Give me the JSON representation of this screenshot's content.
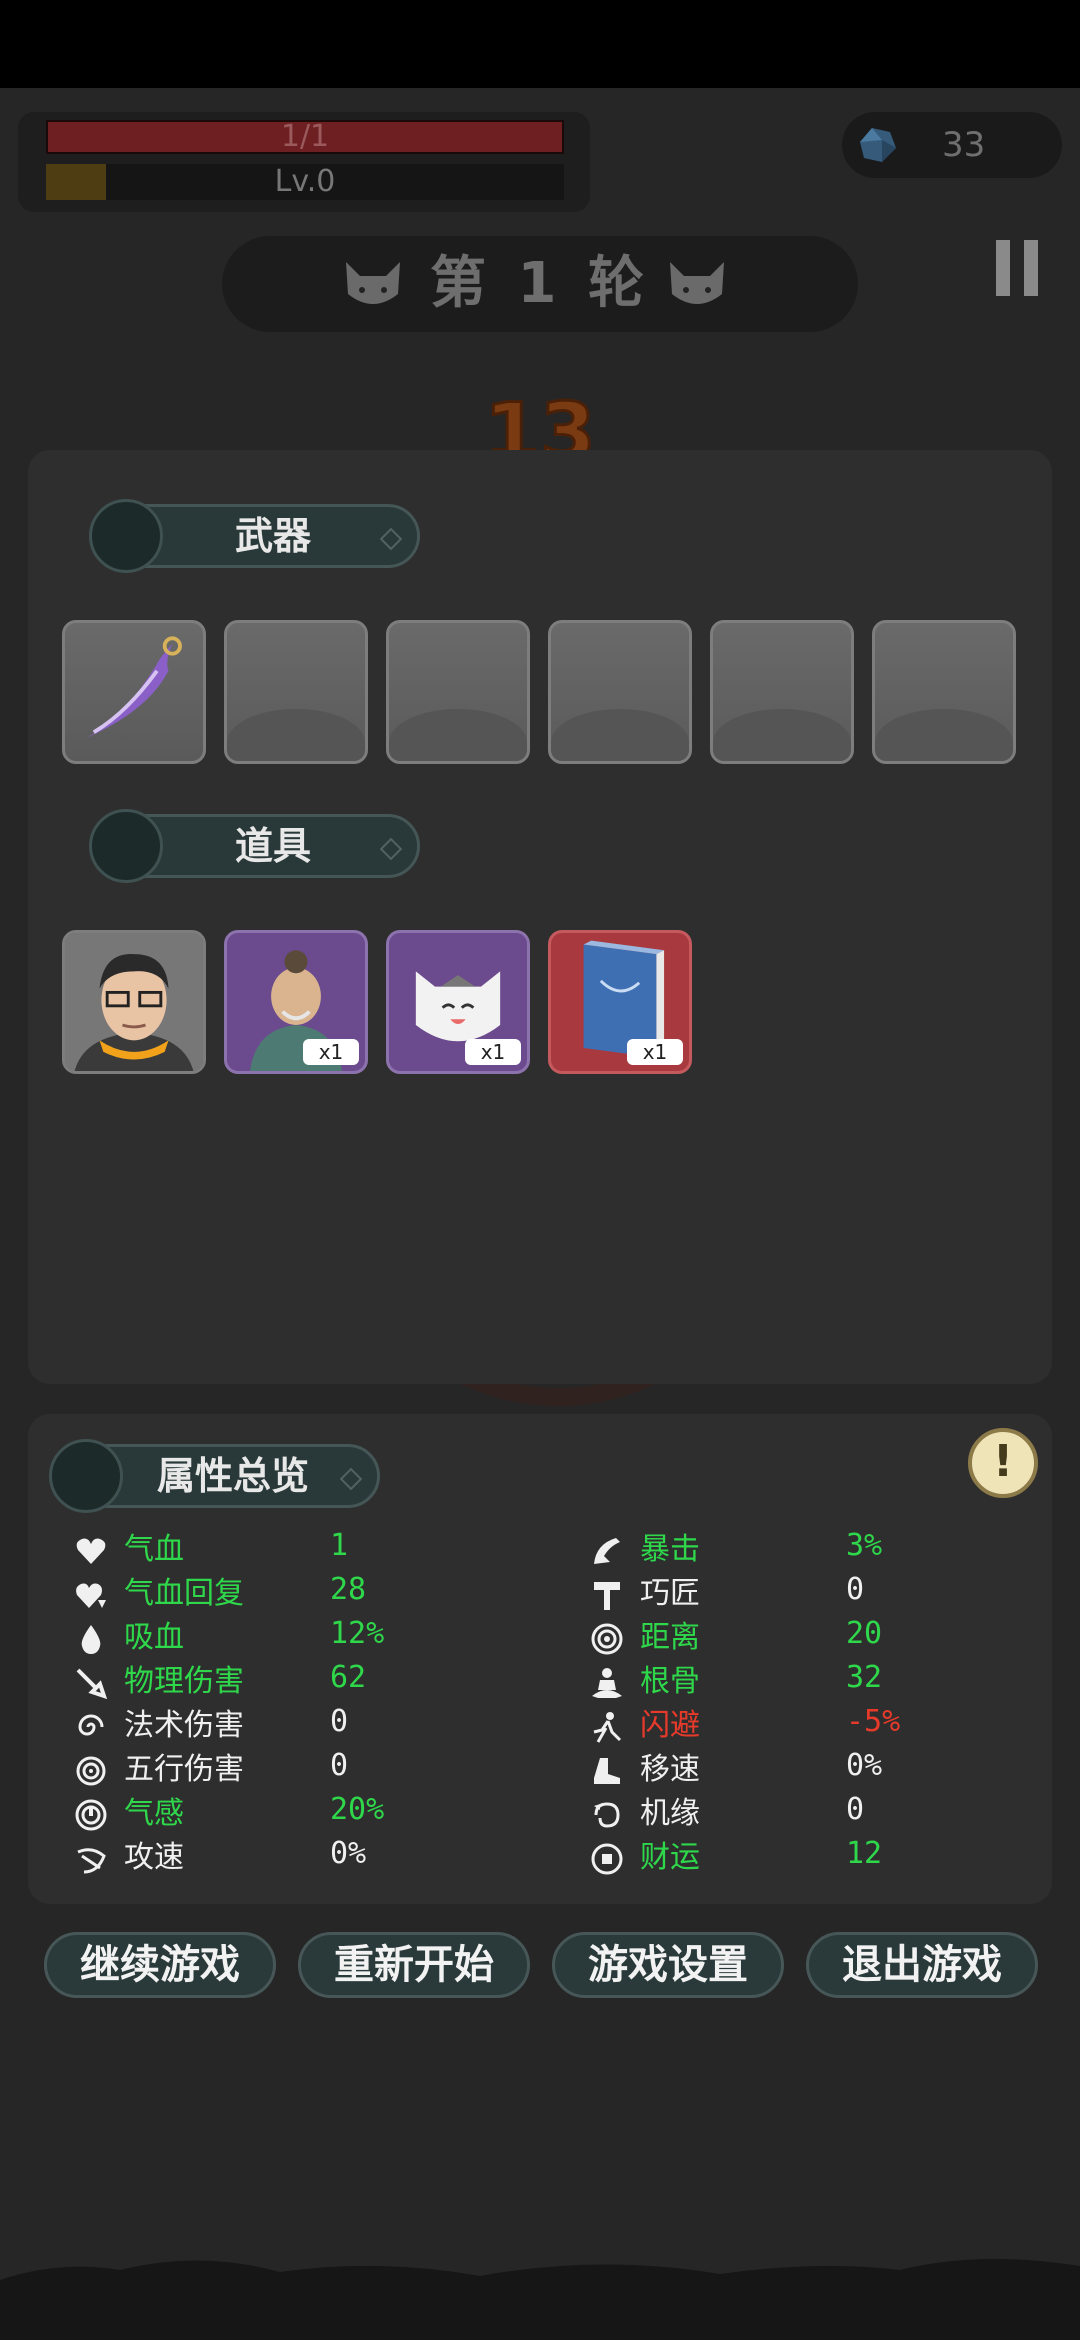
{
  "hud": {
    "hp_text": "1/1",
    "hp_fraction": 1.0,
    "level_text": "Lv.0",
    "gem_count": "33"
  },
  "round": {
    "title": "第 1 轮"
  },
  "timer": "13",
  "weapons": {
    "label": "武器",
    "slots": [
      "purple-scythe-blade",
      "",
      "",
      "",
      "",
      ""
    ]
  },
  "items": {
    "label": "道具",
    "slots": [
      {
        "icon": "glasses-man-portrait",
        "qty": ""
      },
      {
        "icon": "elder-sage-portrait",
        "qty": "x1"
      },
      {
        "icon": "white-cat-portrait",
        "qty": "x1"
      },
      {
        "icon": "blue-book-icon",
        "qty": "x1"
      }
    ]
  },
  "stats": {
    "label": "属性总览",
    "left": [
      {
        "name": "气血",
        "value": "1",
        "icon": "heart-icon",
        "color": "green"
      },
      {
        "name": "气血回复",
        "value": "28",
        "icon": "heart-regen-icon",
        "color": "green"
      },
      {
        "name": "吸血",
        "value": "12%",
        "icon": "blood-drop-icon",
        "color": "green"
      },
      {
        "name": "物理伤害",
        "value": "62",
        "icon": "sword-icon",
        "color": "green"
      },
      {
        "name": "法术伤害",
        "value": "0",
        "icon": "spiral-icon",
        "color": "white"
      },
      {
        "name": "五行伤害",
        "value": "0",
        "icon": "vortex-icon",
        "color": "white"
      },
      {
        "name": "气感",
        "value": "20%",
        "icon": "power-icon",
        "color": "green"
      },
      {
        "name": "攻速",
        "value": "0%",
        "icon": "speed-slash-icon",
        "color": "white"
      }
    ],
    "right": [
      {
        "name": "暴击",
        "value": "3%",
        "icon": "crit-icon",
        "color": "green"
      },
      {
        "name": "巧匠",
        "value": "0",
        "icon": "hammer-icon",
        "color": "white"
      },
      {
        "name": "距离",
        "value": "20",
        "icon": "target-icon",
        "color": "green"
      },
      {
        "name": "根骨",
        "value": "32",
        "icon": "meditate-icon",
        "color": "green"
      },
      {
        "name": "闪避",
        "value": "-5%",
        "icon": "dodge-icon",
        "color": "red"
      },
      {
        "name": "移速",
        "value": "0%",
        "icon": "boot-icon",
        "color": "white"
      },
      {
        "name": "机缘",
        "value": "0",
        "icon": "fortune-swirl-icon",
        "color": "white"
      },
      {
        "name": "财运",
        "value": "12",
        "icon": "coin-icon",
        "color": "green"
      }
    ]
  },
  "menu": {
    "continue": "继续游戏",
    "restart": "重新开始",
    "settings": "游戏设置",
    "quit": "退出游戏"
  },
  "colors": {
    "green": "#2fd84b",
    "white": "#f0f0f0",
    "red": "#e83a2a",
    "button_bg": "#2a3a3a"
  }
}
